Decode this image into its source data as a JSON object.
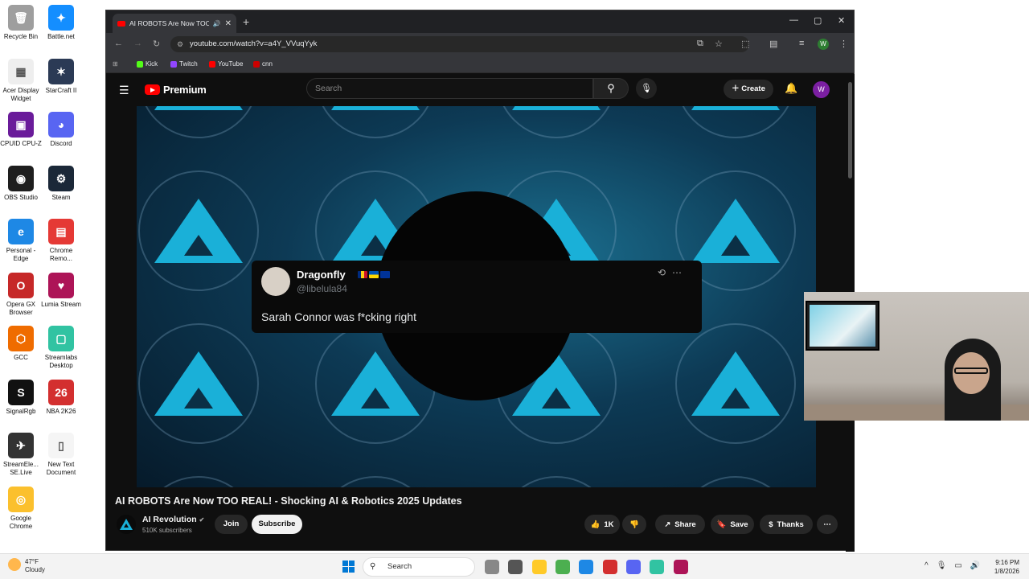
{
  "desktop": {
    "icons": [
      {
        "label": "Recycle Bin",
        "color": "#9e9e9e",
        "glyph": "🗑"
      },
      {
        "label": "Battle.net",
        "color": "#148eff",
        "glyph": "✦"
      },
      {
        "label": "Acer Display Widget",
        "color": "#eeeeee",
        "glyph": "▦"
      },
      {
        "label": "StarCraft II",
        "color": "#2b3a55",
        "glyph": "✶"
      },
      {
        "label": "CPUID CPU-Z",
        "color": "#6a1b9a",
        "glyph": "▣"
      },
      {
        "label": "Discord",
        "color": "#5865f2",
        "glyph": "◕"
      },
      {
        "label": "OBS Studio",
        "color": "#1e1e1e",
        "glyph": "◉"
      },
      {
        "label": "Steam",
        "color": "#1b2838",
        "glyph": "⚙"
      },
      {
        "label": "Personal - Edge",
        "color": "#1e88e5",
        "glyph": "e"
      },
      {
        "label": "Chrome Remo...",
        "color": "#e53935",
        "glyph": "▤"
      },
      {
        "label": "Opera GX Browser",
        "color": "#c62828",
        "glyph": "O"
      },
      {
        "label": "Lumia Stream",
        "color": "#ad1457",
        "glyph": "♥"
      },
      {
        "label": "GCC",
        "color": "#ef6c00",
        "glyph": "⬡"
      },
      {
        "label": "Streamlabs Desktop",
        "color": "#31c3a2",
        "glyph": "▢"
      },
      {
        "label": "SignalRgb",
        "color": "#111111",
        "glyph": "S"
      },
      {
        "label": "NBA 2K26",
        "color": "#d32f2f",
        "glyph": "26"
      },
      {
        "label": "StreamEle... SE.Live",
        "color": "#333333",
        "glyph": "✈"
      },
      {
        "label": "New Text Document",
        "color": "#f5f5f5",
        "glyph": "▯"
      },
      {
        "label": "Google Chrome",
        "color": "#fbc02d",
        "glyph": "◎"
      }
    ]
  },
  "browser": {
    "tab_title": "AI ROBOTS Are Now TOO R",
    "url": "youtube.com/watch?v=a4Y_VVuqYyk",
    "bookmarks": [
      {
        "label": "Kick",
        "color": "#53fc18"
      },
      {
        "label": "Twitch",
        "color": "#9146ff"
      },
      {
        "label": "YouTube",
        "color": "#ff0000"
      },
      {
        "label": "cnn",
        "color": "#cc0000"
      }
    ],
    "profile_initial": "W"
  },
  "youtube": {
    "logo_text": "Premium",
    "search_placeholder": "Search",
    "create_label": "Create",
    "avatar_initial": "W",
    "video": {
      "tweet_name": "Dragonfly",
      "tweet_handle": "@libelula84",
      "tweet_text": "Sarah Connor was f*cking right"
    },
    "title": "AI ROBOTS Are Now TOO REAL! - Shocking AI & Robotics 2025 Updates",
    "channel_name": "AI Revolution",
    "subscribers": "510K subscribers",
    "join_label": "Join",
    "subscribe_label": "Subscribe",
    "likes": "1K",
    "share_label": "Share",
    "save_label": "Save",
    "thanks_label": "Thanks"
  },
  "taskbar": {
    "temperature": "47°F",
    "condition": "Cloudy",
    "search_label": "Search",
    "time": "9:16 PM",
    "date": "1/8/2026",
    "apps": [
      {
        "name": "file-explorer",
        "color": "#ffca28"
      },
      {
        "name": "chrome",
        "color": "#4caf50"
      },
      {
        "name": "edge",
        "color": "#1e88e5"
      },
      {
        "name": "opera",
        "color": "#d32f2f"
      },
      {
        "name": "discord",
        "color": "#5865f2"
      },
      {
        "name": "streamlabs",
        "color": "#31c3a2"
      },
      {
        "name": "lumia",
        "color": "#ad1457"
      }
    ]
  }
}
